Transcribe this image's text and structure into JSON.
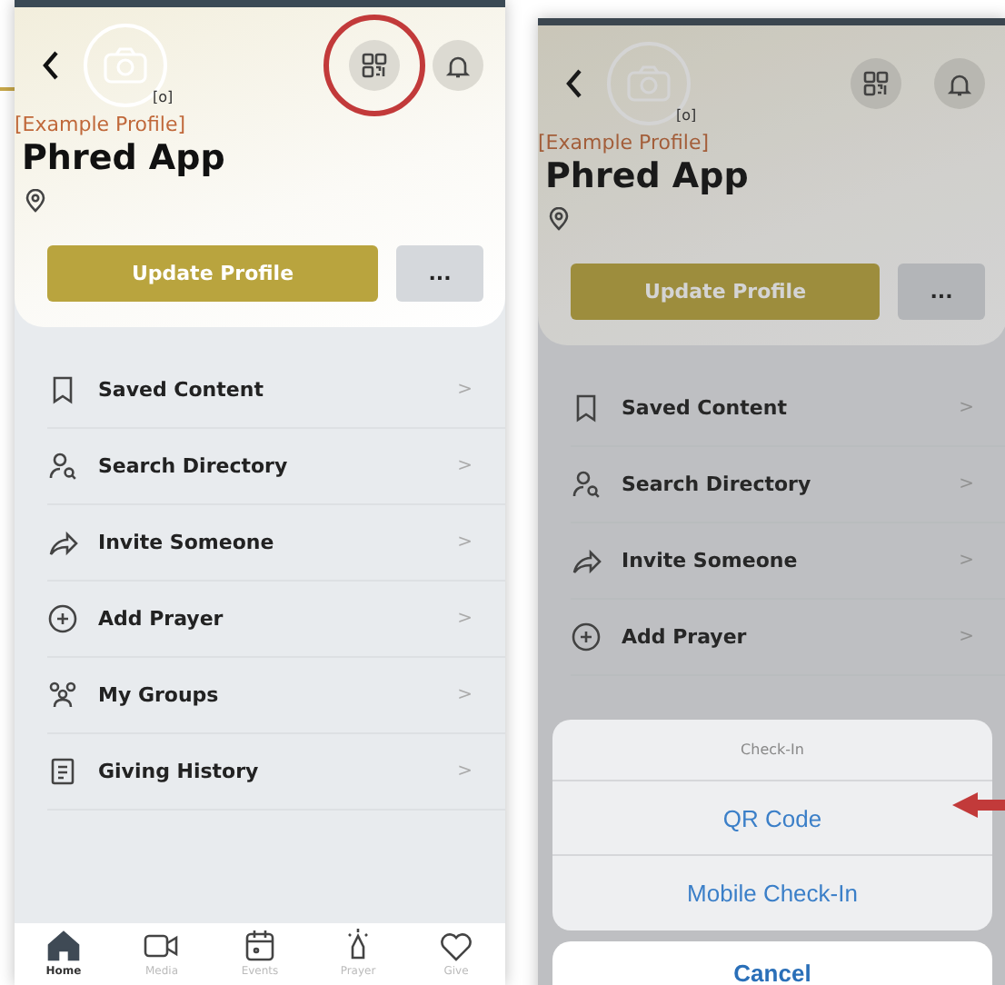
{
  "screens": [
    {
      "dimmed": false,
      "header": {
        "avatar_tag": "[o]",
        "profile_label": "[Example Profile]",
        "name": "Phred App",
        "update_button": "Update Profile",
        "more_button": "...",
        "qr_circled": true
      },
      "menu": [
        {
          "label": "Saved Content",
          "chevron": ">"
        },
        {
          "label": "Search Directory",
          "chevron": ">"
        },
        {
          "label": "Invite Someone",
          "chevron": ">"
        },
        {
          "label": "Add Prayer",
          "chevron": ">"
        },
        {
          "label": "My Groups",
          "chevron": ">"
        },
        {
          "label": "Giving History",
          "chevron": ">"
        }
      ],
      "tab_bar": [
        {
          "label": "Home",
          "selected": true
        },
        {
          "label": "Media",
          "selected": false
        },
        {
          "label": "Events",
          "selected": false
        },
        {
          "label": "Prayer",
          "selected": false
        },
        {
          "label": "Give",
          "selected": false
        }
      ]
    },
    {
      "dimmed": true,
      "header": {
        "avatar_tag": "[o]",
        "profile_label": "[Example Profile]",
        "name": "Phred App",
        "update_button": "Update Profile",
        "more_button": "...",
        "qr_circled": false
      },
      "menu": [
        {
          "label": "Saved Content",
          "chevron": ">"
        },
        {
          "label": "Search Directory",
          "chevron": ">"
        },
        {
          "label": "Invite Someone",
          "chevron": ">"
        },
        {
          "label": "Add Prayer",
          "chevron": ">"
        }
      ],
      "action_sheet": {
        "title": "Check-In",
        "options": [
          {
            "label": "QR Code",
            "pointed": true
          },
          {
            "label": "Mobile Check-In",
            "pointed": false
          }
        ],
        "cancel": "Cancel"
      }
    }
  ]
}
